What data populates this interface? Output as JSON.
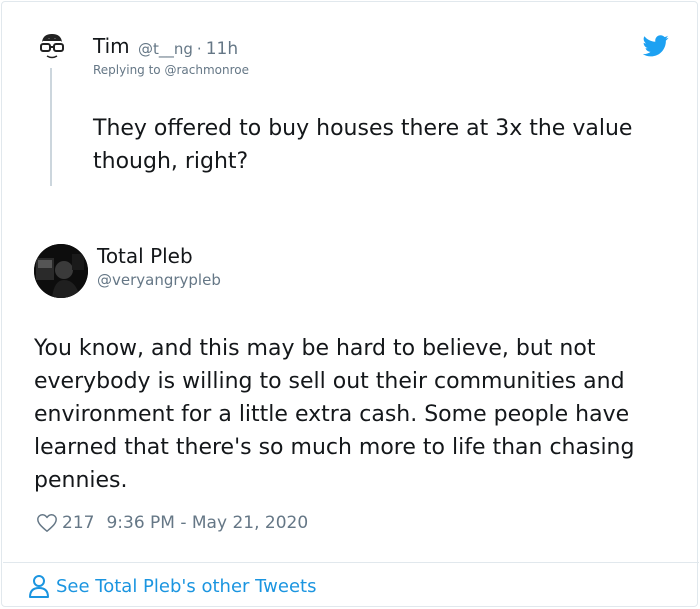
{
  "parent_tweet": {
    "name": "Tim",
    "handle": "@t__ng",
    "separator": "·",
    "time_ago": "11h",
    "replying_to": "Replying to @rachmonroe",
    "text": "They offered to buy houses there at 3x the value though, right?",
    "avatar_icon": "glasses-face-icon"
  },
  "main_tweet": {
    "name": "Total Pleb",
    "handle": "@veryangrypleb",
    "text": "You know, and this may be hard to believe, but not everybody is willing to sell out their communities and environment for a little extra cash. Some people have learned that there's so much more to life than chasing pennies.",
    "likes": "217",
    "timestamp": "9:36 PM - May 21, 2020",
    "avatar_icon": "profile-photo"
  },
  "footer": {
    "see_more": "See Total Pleb's other Tweets",
    "icon": "person-icon"
  },
  "colors": {
    "twitter_blue": "#1da1f2",
    "link_blue": "#1b95e0",
    "muted": "#657786",
    "border": "#e1e8ed"
  }
}
